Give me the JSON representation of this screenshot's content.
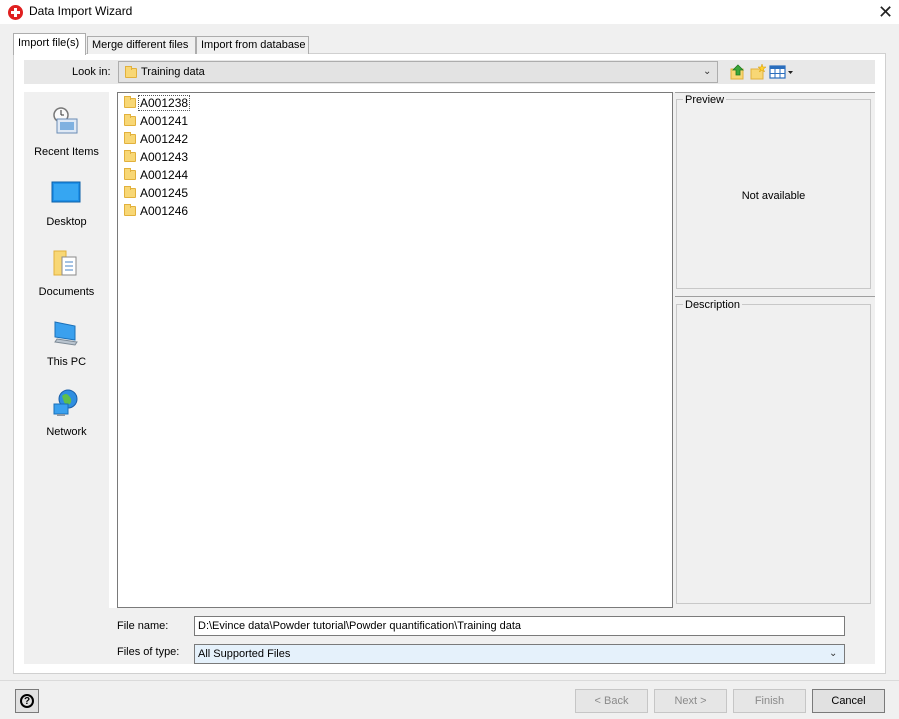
{
  "window": {
    "title": "Data Import Wizard",
    "close_glyph": "✕"
  },
  "tabs": [
    {
      "label": "Import file(s)",
      "active": true
    },
    {
      "label": "Merge different files",
      "active": false
    },
    {
      "label": "Import from database",
      "active": false
    }
  ],
  "lookin": {
    "label": "Look in:",
    "value": "Training data",
    "toolbar_icons": [
      "up-folder-icon",
      "new-folder-icon",
      "view-menu-icon"
    ]
  },
  "places": [
    {
      "label": "Recent Items",
      "icon": "recent-items-icon"
    },
    {
      "label": "Desktop",
      "icon": "desktop-icon"
    },
    {
      "label": "Documents",
      "icon": "documents-icon"
    },
    {
      "label": "This PC",
      "icon": "this-pc-icon"
    },
    {
      "label": "Network",
      "icon": "network-icon"
    }
  ],
  "files": [
    {
      "name": "A001238",
      "selected": true
    },
    {
      "name": "A001241",
      "selected": false
    },
    {
      "name": "A001242",
      "selected": false
    },
    {
      "name": "A001243",
      "selected": false
    },
    {
      "name": "A001244",
      "selected": false
    },
    {
      "name": "A001245",
      "selected": false
    },
    {
      "name": "A001246",
      "selected": false
    }
  ],
  "preview": {
    "title": "Preview",
    "message": "Not available"
  },
  "description": {
    "title": "Description"
  },
  "filename": {
    "label": "File name:",
    "value": "D:\\Evince data\\Powder tutorial\\Powder quantification\\Training data"
  },
  "filetype": {
    "label": "Files of type:",
    "value": "All Supported Files"
  },
  "buttons": {
    "help": "?",
    "back": "< Back",
    "next": "Next >",
    "finish": "Finish",
    "cancel": "Cancel"
  },
  "colors": {
    "app_icon": "#e02020",
    "folder": "#f8d775",
    "select_highlight": "#e5f1fb"
  }
}
